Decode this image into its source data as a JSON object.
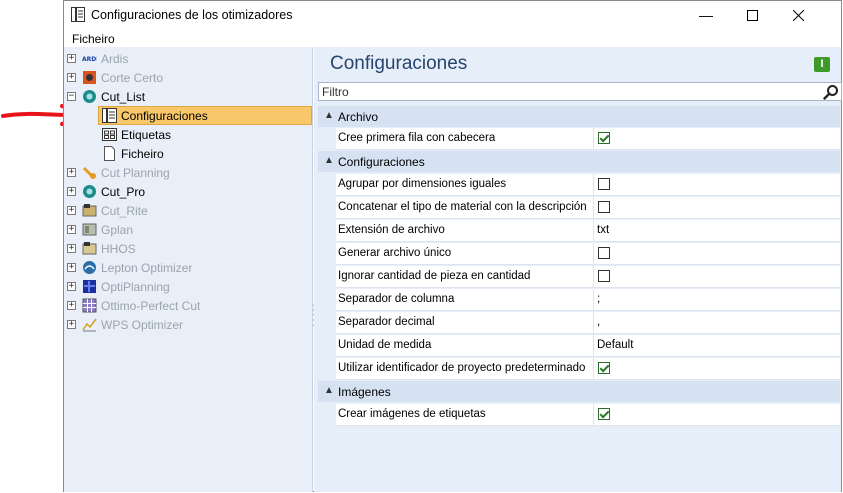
{
  "window": {
    "title": "Configuraciones de los otimizadores",
    "controls": [
      "minimize",
      "maximize",
      "close"
    ]
  },
  "menu": {
    "file_label": "Ficheiro"
  },
  "tree": {
    "items": [
      {
        "label": "Ardis",
        "dim": true,
        "expander": "+",
        "icon": "ardis-logo-icon"
      },
      {
        "label": "Corte Certo",
        "dim": true,
        "expander": "+",
        "icon": "corte-certo-icon"
      },
      {
        "label": "Cut_List",
        "dim": false,
        "expander": "−",
        "icon": "cut-list-globe-icon"
      },
      {
        "label": "Configuraciones",
        "dim": false,
        "selected": true,
        "icon": "settings-sheet-icon"
      },
      {
        "label": "Etiquetas",
        "dim": false,
        "icon": "labels-icon"
      },
      {
        "label": "Ficheiro",
        "dim": false,
        "icon": "document-icon"
      },
      {
        "label": "Cut Planning",
        "dim": true,
        "expander": "+",
        "icon": "cut-planning-icon"
      },
      {
        "label": "Cut_Pro",
        "dim": false,
        "expander": "+",
        "icon": "cut-pro-globe-icon"
      },
      {
        "label": "Cut_Rite",
        "dim": true,
        "expander": "+",
        "icon": "cut-rite-icon"
      },
      {
        "label": "Gplan",
        "dim": true,
        "expander": "+",
        "icon": "gplan-icon"
      },
      {
        "label": "HHOS",
        "dim": true,
        "expander": "+",
        "icon": "hhos-icon"
      },
      {
        "label": "Lepton Optimizer",
        "dim": true,
        "expander": "+",
        "icon": "lepton-icon"
      },
      {
        "label": "OptiPlanning",
        "dim": true,
        "expander": "+",
        "icon": "optiplanning-icon"
      },
      {
        "label": "Ottimo-Perfect Cut",
        "dim": true,
        "expander": "+",
        "icon": "ottimo-grid-icon"
      },
      {
        "label": "WPS Optimizer",
        "dim": true,
        "expander": "+",
        "icon": "wps-chart-icon"
      }
    ]
  },
  "panel": {
    "title": "Configuraciones",
    "filter_placeholder": "Filtro",
    "info_label": "I"
  },
  "properties": {
    "categories": [
      {
        "name": "Archivo",
        "rows": [
          {
            "label": "Cree primera fila con cabecera",
            "type": "checkbox",
            "checked": true
          }
        ]
      },
      {
        "name": "Configuraciones",
        "rows": [
          {
            "label": "Agrupar por dimensiones iguales",
            "type": "checkbox",
            "checked": false
          },
          {
            "label": "Concatenar el tipo de material con la descripción",
            "type": "checkbox",
            "checked": false
          },
          {
            "label": "Extensión de archivo",
            "type": "text",
            "value": "txt"
          },
          {
            "label": "Generar archivo único",
            "type": "checkbox",
            "checked": false
          },
          {
            "label": "Ignorar cantidad de pieza en cantidad",
            "type": "checkbox",
            "checked": false
          },
          {
            "label": "Separador de columna",
            "type": "text",
            "value": ";"
          },
          {
            "label": "Separador decimal",
            "type": "text",
            "value": ","
          },
          {
            "label": "Unidad de medida",
            "type": "text",
            "value": "Default"
          },
          {
            "label": "Utilizar identificador de proyecto predeterminado",
            "type": "checkbox",
            "checked": true
          }
        ]
      },
      {
        "name": "Imágenes",
        "rows": [
          {
            "label": "Crear imágenes de etiquetas",
            "type": "checkbox",
            "checked": true
          }
        ]
      }
    ]
  },
  "colors": {
    "selection": "#f8c76a",
    "annotation_arrow": "#e8141a",
    "panel_title": "#27456d"
  }
}
